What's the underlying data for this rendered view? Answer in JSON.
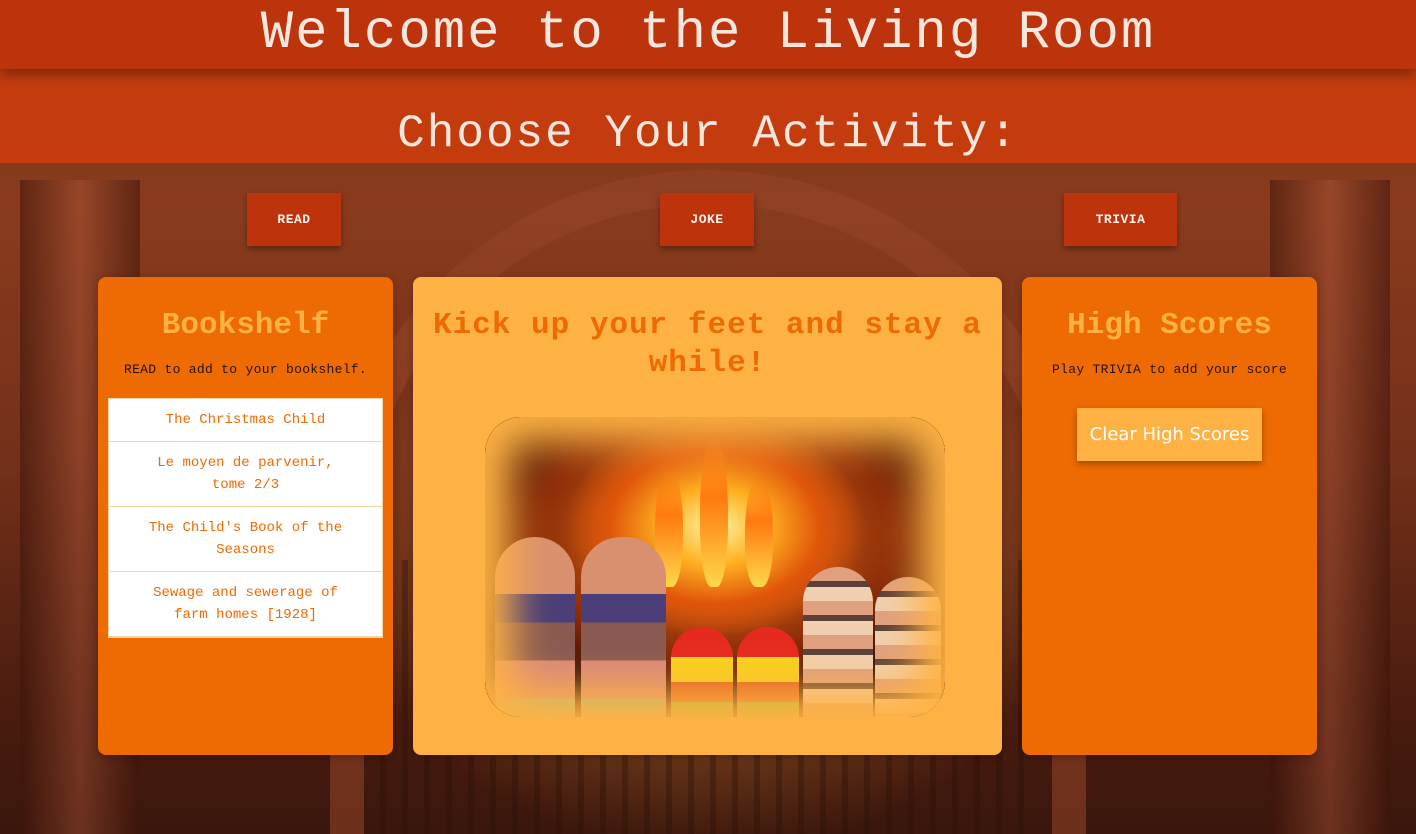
{
  "header": {
    "title": "Welcome to the Living Room",
    "subtitle": "Choose Your Activity:"
  },
  "activities": {
    "read": "READ",
    "joke": "JOKE",
    "trivia": "TRIVIA"
  },
  "bookshelf": {
    "title": "Bookshelf",
    "hint": "READ to add to your bookshelf.",
    "books": [
      "The Christmas Child",
      "Le moyen de parvenir, tome 2/3",
      "The Child's Book of the Seasons",
      "Sewage and sewerage of farm homes [1928]"
    ]
  },
  "main": {
    "title": "Kick up your feet and stay a while!",
    "image_icon": "cozy-fireplace-socks-image"
  },
  "high_scores": {
    "title": "High Scores",
    "hint": "Play TRIVIA to add your score",
    "clear_label": "Clear High Scores"
  },
  "colors": {
    "header": "#bd330c",
    "header_secondary": "#c43c0e",
    "side_card": "#ee6a02",
    "center_card": "#ffb244",
    "text_light": "#f6e6dc"
  }
}
